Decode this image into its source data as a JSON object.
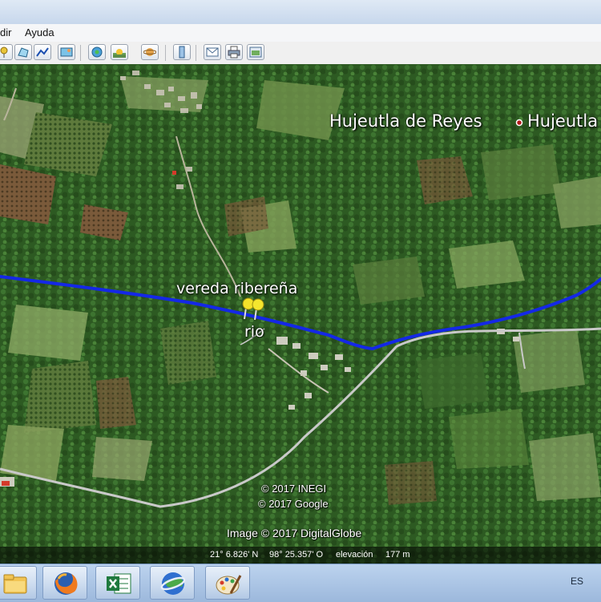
{
  "menu": {
    "items": [
      "dir",
      "Ayuda"
    ]
  },
  "toolbar": {
    "icons": [
      "add-placemark-icon",
      "add-polygon-icon",
      "add-path-icon",
      "add-image-overlay-icon",
      "record-tour-icon",
      "show-historical-imagery-icon",
      "sunlight-icon",
      "switch-planet-icon",
      "ruler-icon",
      "email-icon",
      "print-icon",
      "save-image-icon"
    ]
  },
  "map": {
    "places": [
      {
        "label": "Hujeutla de Reyes",
        "icon": "town-dot-icon"
      },
      {
        "label": "Hujeutla",
        "icon": "town-dot-icon"
      }
    ],
    "placemarks": [
      {
        "label": "vereda ribereña",
        "icon": "yellow-pushpin-icon"
      },
      {
        "label": "rio",
        "icon": "yellow-pushpin-icon"
      }
    ],
    "route_color": "#1428e6",
    "road_color": "#c9c9c9",
    "attribution": {
      "line1": "© 2017 INEGI",
      "line2": "© 2017 Google",
      "line3": "Image © 2017 DigitalGlobe"
    }
  },
  "status": {
    "latitude": "21° 6.826' N",
    "longitude": "98° 25.357' O",
    "elevation_label": "elevación",
    "elevation_value": "177 m"
  },
  "taskbar": {
    "apps": [
      "file-explorer-icon",
      "firefox-icon",
      "excel-icon",
      "google-earth-icon",
      "paint-icon"
    ],
    "language": "ES"
  }
}
